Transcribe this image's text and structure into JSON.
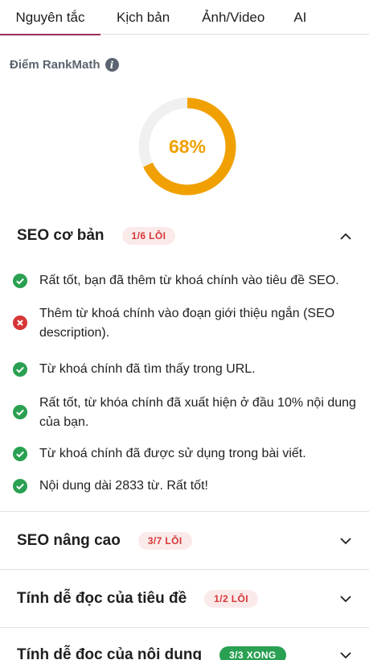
{
  "tabs": [
    {
      "label": "Nguyên tắc",
      "active": true
    },
    {
      "label": "Kịch bản",
      "active": false
    },
    {
      "label": "Ảnh/Video",
      "active": false
    },
    {
      "label": "AI",
      "active": false
    }
  ],
  "score": {
    "title": "Điểm RankMath",
    "value_label": "68%",
    "fraction": 0.68,
    "color": "#f0a000",
    "track_color": "#f0f0f1"
  },
  "sections": [
    {
      "title": "SEO cơ bản",
      "badge": "1/6 LỖI",
      "badge_type": "error",
      "expanded": true,
      "checks": [
        {
          "status": "pass",
          "text": "Rất tốt, bạn đã thêm từ khoá chính vào tiêu đề SEO."
        },
        {
          "status": "fail",
          "text": "Thêm từ khoá chính vào đoạn giới thiệu ngắn (SEO description)."
        },
        {
          "status": "pass",
          "text": "Từ khoá chính đã tìm thấy trong URL."
        },
        {
          "status": "pass",
          "text": "Rất tốt, từ khóa chính đã xuất hiện ở đầu 10% nội dung của bạn."
        },
        {
          "status": "pass",
          "text": "Từ khoá chính đã được sử dụng trong bài viết."
        },
        {
          "status": "pass",
          "text": "Nội dung dài 2833 từ. Rất tốt!"
        }
      ]
    },
    {
      "title": "SEO nâng cao",
      "badge": "3/7 LỖI",
      "badge_type": "error",
      "expanded": false
    },
    {
      "title": "Tính dễ đọc của tiêu đề",
      "badge": "1/2 LỖI",
      "badge_type": "error",
      "expanded": false
    },
    {
      "title": "Tính dễ đọc của nội dung",
      "badge": "3/3 XONG",
      "badge_type": "ok",
      "expanded": false
    }
  ],
  "colors": {
    "pass": "#2aa052",
    "fail": "#d63638",
    "tab_active_underline": "#9c2b5b"
  }
}
